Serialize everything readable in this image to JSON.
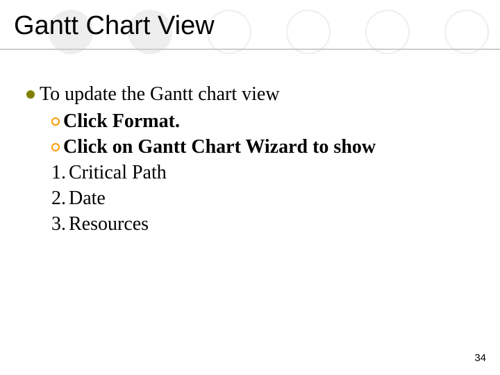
{
  "title": "Gantt Chart View",
  "body": {
    "l1": "To update the Gantt chart view",
    "l2a": "Click Format.",
    "l2b": "Click on  Gantt Chart Wizard to show",
    "ordered": {
      "n1": "1.",
      "t1": "Critical Path",
      "n2": "2.",
      "t2": "Date",
      "n3": "3.",
      "t3": "Resources"
    }
  },
  "page_number": "34"
}
